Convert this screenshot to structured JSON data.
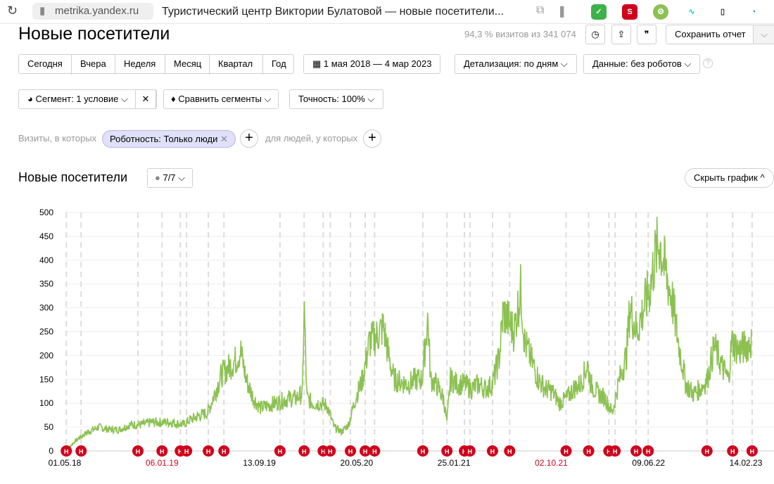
{
  "browser": {
    "url": "metrika.yandex.ru",
    "tab_title": "Туристический центр Виктории Булатовой — новые посетители..."
  },
  "header": {
    "title": "Новые посетители",
    "visits_info": "94,3 % визитов из 341 074",
    "save_label": "Сохранить отчет"
  },
  "periods": [
    "Сегодня",
    "Вчера",
    "Неделя",
    "Месяц",
    "Квартал",
    "Год"
  ],
  "date_range": "1 мая 2018 — 4 мар 2023",
  "detail": "Детализация: по дням",
  "data_filter": "Данные: без роботов",
  "segment": "Сегмент: 1 условие",
  "compare": "Сравнить сегменты",
  "accuracy": "Точность: 100%",
  "filter": {
    "prefix": "Визиты, в которых",
    "chip": "Роботность: Только люди",
    "people": "для людей, у которых"
  },
  "chart_section": {
    "title": "Новые посетители",
    "notes": "7/7",
    "hide": "Скрыть график"
  },
  "colors": {
    "line": "#8cc152",
    "marker": "#d0021b"
  },
  "chart_data": {
    "type": "line",
    "title": "Новые посетители",
    "x_unit": "days since 01.05.18",
    "ylim": [
      0,
      500
    ],
    "y_ticks": [
      "0",
      "50",
      "100",
      "150",
      "200",
      "250",
      "300",
      "350",
      "400",
      "450",
      "500"
    ],
    "x_ticks": [
      {
        "day": 0,
        "label": "01.05.18",
        "holiday": false
      },
      {
        "day": 250,
        "label": "06.01.19",
        "holiday": true
      },
      {
        "day": 500,
        "label": "13.09.19",
        "holiday": false
      },
      {
        "day": 750,
        "label": "20.05.20",
        "holiday": false
      },
      {
        "day": 1000,
        "label": "25.01.21",
        "holiday": false
      },
      {
        "day": 1250,
        "label": "02.10.21",
        "holiday": true
      },
      {
        "day": 1500,
        "label": "09.06.22",
        "holiday": false
      },
      {
        "day": 1750,
        "label": "14.02.23",
        "holiday": false
      }
    ],
    "points": [
      [
        0,
        0
      ],
      [
        14,
        10
      ],
      [
        33,
        25
      ],
      [
        60,
        40
      ],
      [
        87,
        50
      ],
      [
        114,
        45
      ],
      [
        141,
        45
      ],
      [
        168,
        55
      ],
      [
        195,
        55
      ],
      [
        222,
        60
      ],
      [
        250,
        60
      ],
      [
        277,
        60
      ],
      [
        304,
        55
      ],
      [
        322,
        65
      ],
      [
        349,
        75
      ],
      [
        367,
        80
      ],
      [
        385,
        120
      ],
      [
        403,
        160
      ],
      [
        421,
        175
      ],
      [
        439,
        190
      ],
      [
        452,
        210
      ],
      [
        466,
        150
      ],
      [
        485,
        110
      ],
      [
        503,
        90
      ],
      [
        521,
        95
      ],
      [
        539,
        100
      ],
      [
        557,
        105
      ],
      [
        575,
        110
      ],
      [
        593,
        110
      ],
      [
        611,
        120
      ],
      [
        615,
        310
      ],
      [
        622,
        110
      ],
      [
        638,
        100
      ],
      [
        656,
        100
      ],
      [
        674,
        95
      ],
      [
        692,
        50
      ],
      [
        711,
        40
      ],
      [
        729,
        55
      ],
      [
        747,
        110
      ],
      [
        765,
        150
      ],
      [
        783,
        230
      ],
      [
        801,
        240
      ],
      [
        819,
        260
      ],
      [
        832,
        200
      ],
      [
        846,
        150
      ],
      [
        864,
        145
      ],
      [
        882,
        140
      ],
      [
        900,
        150
      ],
      [
        918,
        150
      ],
      [
        933,
        280
      ],
      [
        940,
        150
      ],
      [
        955,
        140
      ],
      [
        973,
        110
      ],
      [
        982,
        60
      ],
      [
        991,
        150
      ],
      [
        1009,
        140
      ],
      [
        1027,
        140
      ],
      [
        1045,
        130
      ],
      [
        1063,
        140
      ],
      [
        1081,
        130
      ],
      [
        1099,
        140
      ],
      [
        1117,
        200
      ],
      [
        1126,
        290
      ],
      [
        1135,
        280
      ],
      [
        1154,
        250
      ],
      [
        1172,
        340
      ],
      [
        1181,
        230
      ],
      [
        1199,
        190
      ],
      [
        1217,
        150
      ],
      [
        1235,
        130
      ],
      [
        1253,
        125
      ],
      [
        1271,
        100
      ],
      [
        1289,
        110
      ],
      [
        1307,
        130
      ],
      [
        1325,
        140
      ],
      [
        1343,
        180
      ],
      [
        1352,
        140
      ],
      [
        1370,
        120
      ],
      [
        1389,
        110
      ],
      [
        1407,
        80
      ],
      [
        1425,
        150
      ],
      [
        1443,
        200
      ],
      [
        1452,
        300
      ],
      [
        1470,
        250
      ],
      [
        1488,
        300
      ],
      [
        1506,
        350
      ],
      [
        1515,
        400
      ],
      [
        1528,
        440
      ],
      [
        1542,
        380
      ],
      [
        1560,
        320
      ],
      [
        1578,
        220
      ],
      [
        1596,
        140
      ],
      [
        1615,
        120
      ],
      [
        1633,
        130
      ],
      [
        1651,
        150
      ],
      [
        1669,
        220
      ],
      [
        1687,
        180
      ],
      [
        1705,
        150
      ],
      [
        1714,
        230
      ],
      [
        1732,
        210
      ],
      [
        1750,
        220
      ],
      [
        1765,
        230
      ]
    ],
    "annotation_days": [
      4,
      42,
      188,
      250,
      297,
      313,
      369,
      409,
      553,
      615,
      664,
      682,
      734,
      772,
      796,
      920,
      982,
      1027,
      1041,
      1099,
      1143,
      1288,
      1346,
      1398,
      1414,
      1468,
      1499,
      1650,
      1716,
      1766
    ],
    "annotation_label": "Н"
  }
}
